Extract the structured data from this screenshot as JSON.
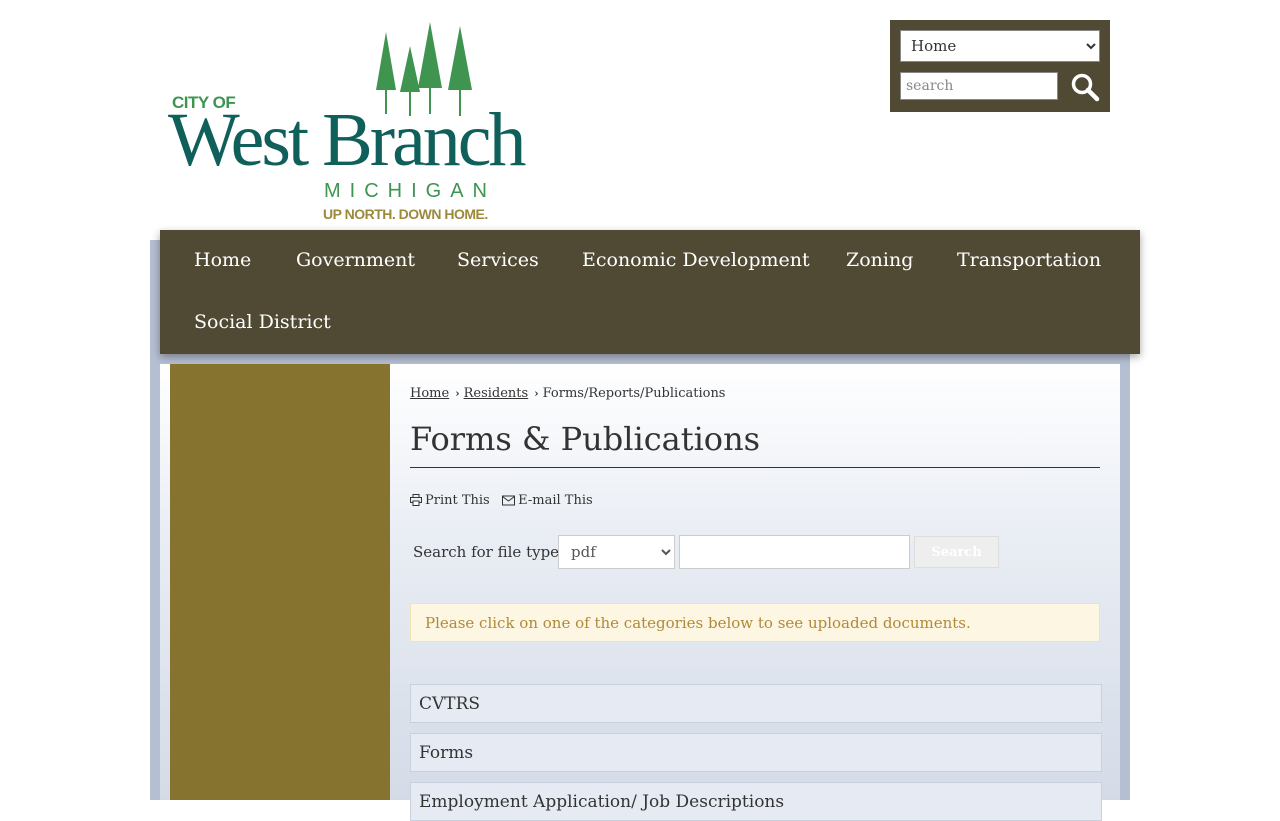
{
  "header": {
    "logo": {
      "city_of": "CITY OF",
      "name": "West Branch",
      "state": "MICHIGAN",
      "tagline": "UP NORTH. DOWN HOME."
    },
    "site_select": {
      "selected": "Home"
    },
    "search": {
      "placeholder": "search",
      "icon": "search-icon"
    }
  },
  "nav": {
    "items": [
      "Home",
      "Government",
      "Services",
      "Economic Development",
      "Zoning",
      "Transportation",
      "Social District"
    ]
  },
  "breadcrumb": {
    "home": "Home",
    "residents": "Residents",
    "current": "Forms/Reports/Publications"
  },
  "page": {
    "title": "Forms & Publications",
    "print_label": "Print This",
    "email_label": "E-mail This"
  },
  "file_search": {
    "label": "Search for file type:",
    "selected_type": "pdf",
    "button": "Search"
  },
  "notice": "Please click on one of the categories below to see uploaded documents.",
  "categories": [
    "CVTRS",
    "Forms",
    "Employment Application/ Job Descriptions"
  ],
  "colors": {
    "nav_bg": "#504a35",
    "sidebar_bg": "#85732f",
    "logo_teal": "#0f5f5b",
    "logo_green": "#3f9450",
    "logo_gold": "#9c8a3c",
    "notice_text": "#b08a3a"
  }
}
